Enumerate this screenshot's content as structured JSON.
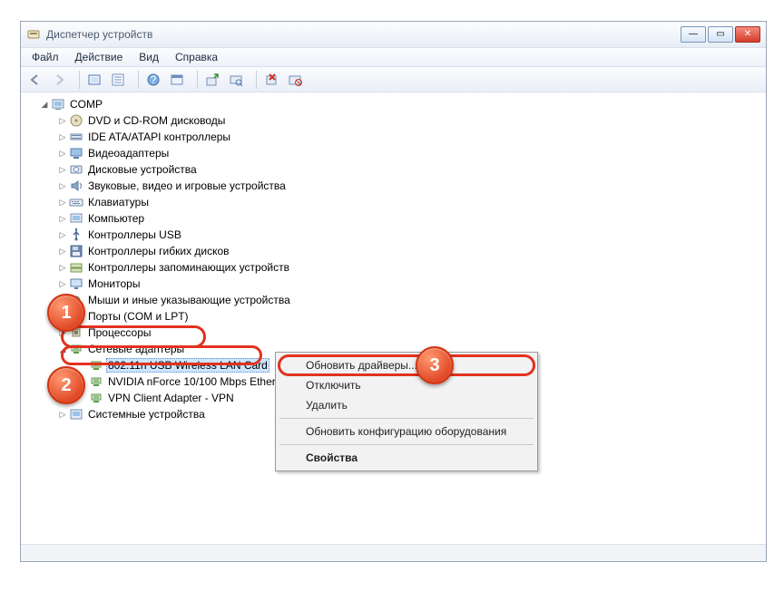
{
  "title": "Диспетчер устройств",
  "menu": {
    "file": "Файл",
    "action": "Действие",
    "view": "Вид",
    "help": "Справка"
  },
  "tree": {
    "root": "COMP",
    "items": [
      "DVD и CD-ROM дисководы",
      "IDE ATA/ATAPI контроллеры",
      "Видеоадаптеры",
      "Дисковые устройства",
      "Звуковые, видео и игровые устройства",
      "Клавиатуры",
      "Компьютер",
      "Контроллеры USB",
      "Контроллеры гибких дисков",
      "Контроллеры запоминающих устройств",
      "Мониторы",
      "Мыши и иные указывающие устройства",
      "Порты (COM и LPT)",
      "Процессоры",
      "Сетевые адаптеры",
      "Системные устройства"
    ],
    "network_children": [
      "802.11n USB Wireless LAN Card",
      "NVIDIA nForce 10/100 Mbps Ethernet",
      "VPN Client Adapter - VPN"
    ]
  },
  "ctx": {
    "update": "Обновить драйверы...",
    "disable": "Отключить",
    "remove": "Удалить",
    "rescan": "Обновить конфигурацию оборудования",
    "props": "Свойства"
  },
  "badges": {
    "b1": "1",
    "b2": "2",
    "b3": "3"
  }
}
